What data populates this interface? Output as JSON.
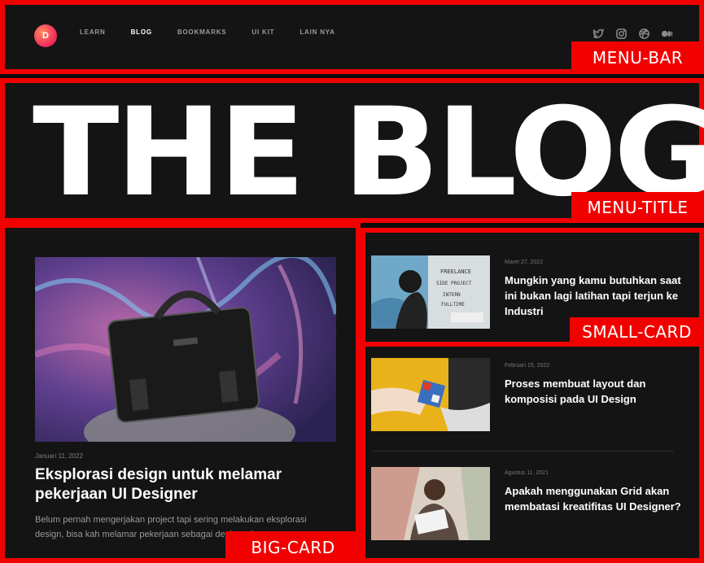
{
  "header": {
    "logo_letter": "D",
    "nav": [
      {
        "label": "LEARN"
      },
      {
        "label": "BLOG"
      },
      {
        "label": "BOOKMARKS"
      },
      {
        "label": "UI KIT"
      },
      {
        "label": "LAIN NYA"
      }
    ],
    "active_nav": "BLOG",
    "socials": [
      "twitter-icon",
      "instagram-icon",
      "dribbble-icon",
      "medium-icon"
    ]
  },
  "hero": {
    "title": "THE BLOG"
  },
  "featured": {
    "date": "Januari 11, 2022",
    "title": "Eksplorasi design untuk melamar pekerjaan UI Designer",
    "excerpt": "Belum pernah mengerjakan project tapi sering melakukan eksplorasi design, bisa kah melamar pekerjaan sebagai designer?"
  },
  "posts": [
    {
      "date": "Maret 27, 2022",
      "title": "Mungkin yang kamu butuhkan saat ini bukan lagi latihan tapi terjun ke Industri"
    },
    {
      "date": "Februari 15, 2022",
      "title": "Proses membuat layout dan komposisi pada UI Design"
    },
    {
      "date": "Agustus 11, 2021",
      "title": "Apakah menggunakan Grid akan membatasi kreatifitas UI Designer?"
    }
  ],
  "annotations": {
    "menu_bar": "MENU-BAR",
    "menu_title": "MENU-TITLE",
    "small_card": "SMALL-CARD",
    "big_card": "BIG-CARD"
  },
  "colors": {
    "annotation_red": "#f20000",
    "background": "#141414",
    "accent_yellow": "#e9b21a"
  }
}
